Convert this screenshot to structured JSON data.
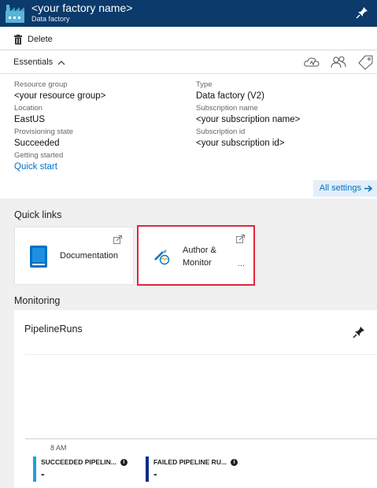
{
  "header": {
    "title": "<your factory name>",
    "subtitle": "Data factory",
    "icon": "factory-icon",
    "pin_icon": "pin-icon",
    "background": "#0b3a6b"
  },
  "command_bar": {
    "delete_label": "Delete",
    "delete_icon": "trash-icon"
  },
  "essentials": {
    "title": "Essentials",
    "toggle_icon": "chevron-up-icon",
    "icons": [
      "cloud-icon",
      "users-icon",
      "tag-icon"
    ],
    "left": [
      {
        "label": "Resource group",
        "value": "<your resource group>",
        "link": false
      },
      {
        "label": "Location",
        "value": "EastUS",
        "link": false
      },
      {
        "label": "Provisioning state",
        "value": "Succeeded",
        "link": false
      },
      {
        "label": "Getting started",
        "value": "Quick start",
        "link": true
      }
    ],
    "right": [
      {
        "label": "Type",
        "value": "Data factory (V2)"
      },
      {
        "label": "Subscription name",
        "value": "<your subscription name>"
      },
      {
        "label": "Subscription id",
        "value": "<your subscription id>"
      }
    ],
    "all_settings_label": "All settings"
  },
  "quick_links": {
    "title": "Quick links",
    "tiles": [
      {
        "label": "Documentation",
        "icon": "book-icon"
      },
      {
        "label": "Author & Monitor",
        "icon": "author-monitor-icon",
        "more": "..."
      }
    ]
  },
  "monitoring": {
    "title": "Monitoring",
    "chart_title": "PipelineRuns",
    "time_label": "8 AM",
    "legend": [
      {
        "name": "SUCCEEDED PIPELIN...",
        "value": "-",
        "color": "#1ba1e2"
      },
      {
        "name": "FAILED PIPELINE RU...",
        "value": "-",
        "color": "#002b8a"
      }
    ]
  },
  "colors": {
    "accent": "#0072c6",
    "highlight_border": "#e0263a"
  }
}
